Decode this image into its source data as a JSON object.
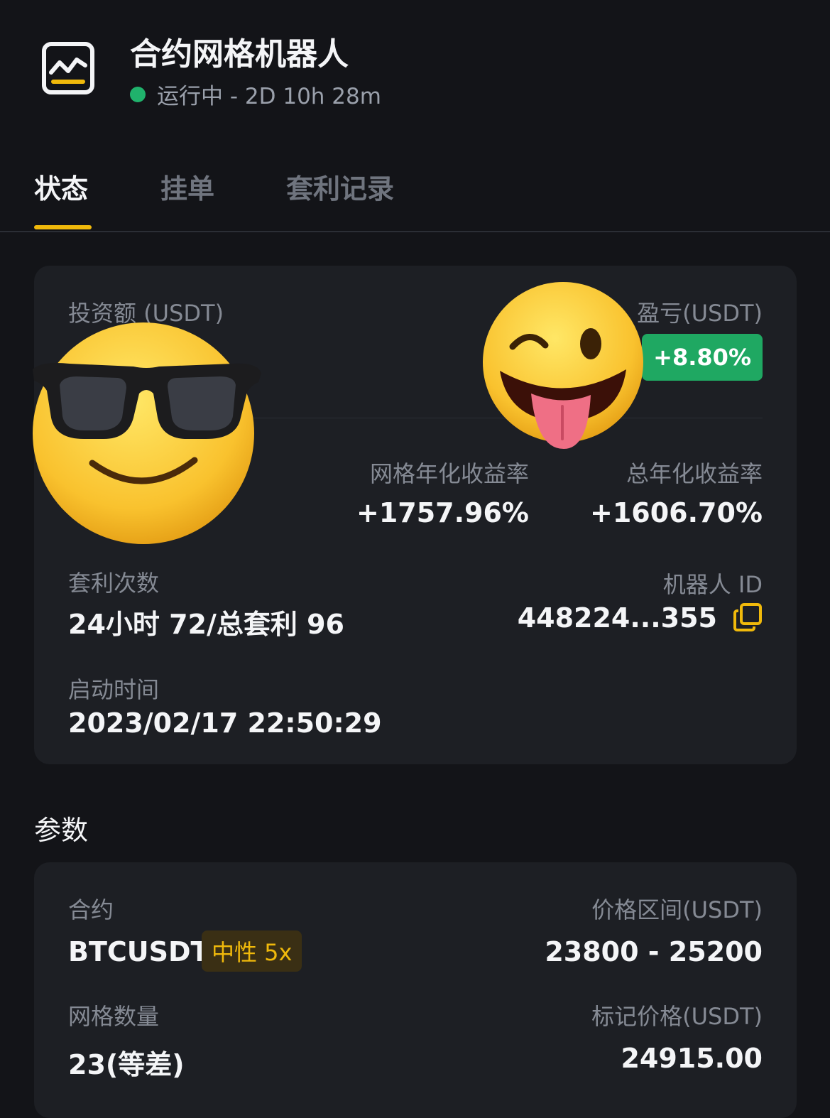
{
  "header": {
    "title": "合约网格机器人",
    "status": "运行中 - 2D 10h 28m"
  },
  "tabs": [
    {
      "label": "状态"
    },
    {
      "label": "挂单"
    },
    {
      "label": "套利记录"
    }
  ],
  "status_card": {
    "investment_label": "投资额 (USDT)",
    "pnl_label": "盈亏(USDT)",
    "pnl_percent": "+8.80%",
    "grid_apy_label": "网格年化收益率",
    "grid_apy": "+1757.96%",
    "total_apy_label": "总年化收益率",
    "total_apy": "+1606.70%",
    "arb_label": "套利次数",
    "arb_value": "24小时 72/总套利 96",
    "robot_id_label": "机器人 ID",
    "robot_id": "448224...355",
    "start_label": "启动时间",
    "start_value": "2023/02/17 22:50:29"
  },
  "params": {
    "section_title": "参数",
    "contract_label": "合约",
    "contract_value": "BTCUSDT",
    "contract_tag": "中性 5x",
    "range_label": "价格区间(USDT)",
    "range_value": "23800 - 25200",
    "grid_count_label": "网格数量",
    "grid_count_value": "23(等差)",
    "mark_price_label": "标记价格(USDT)",
    "mark_price_value": "24915.00"
  },
  "colors": {
    "accent": "#f0b90b",
    "positive": "#1fa862",
    "running": "#20b26c"
  },
  "icons": [
    "grid-bot-icon",
    "copy-icon",
    "sunglasses-emoji",
    "winking-tongue-emoji"
  ]
}
